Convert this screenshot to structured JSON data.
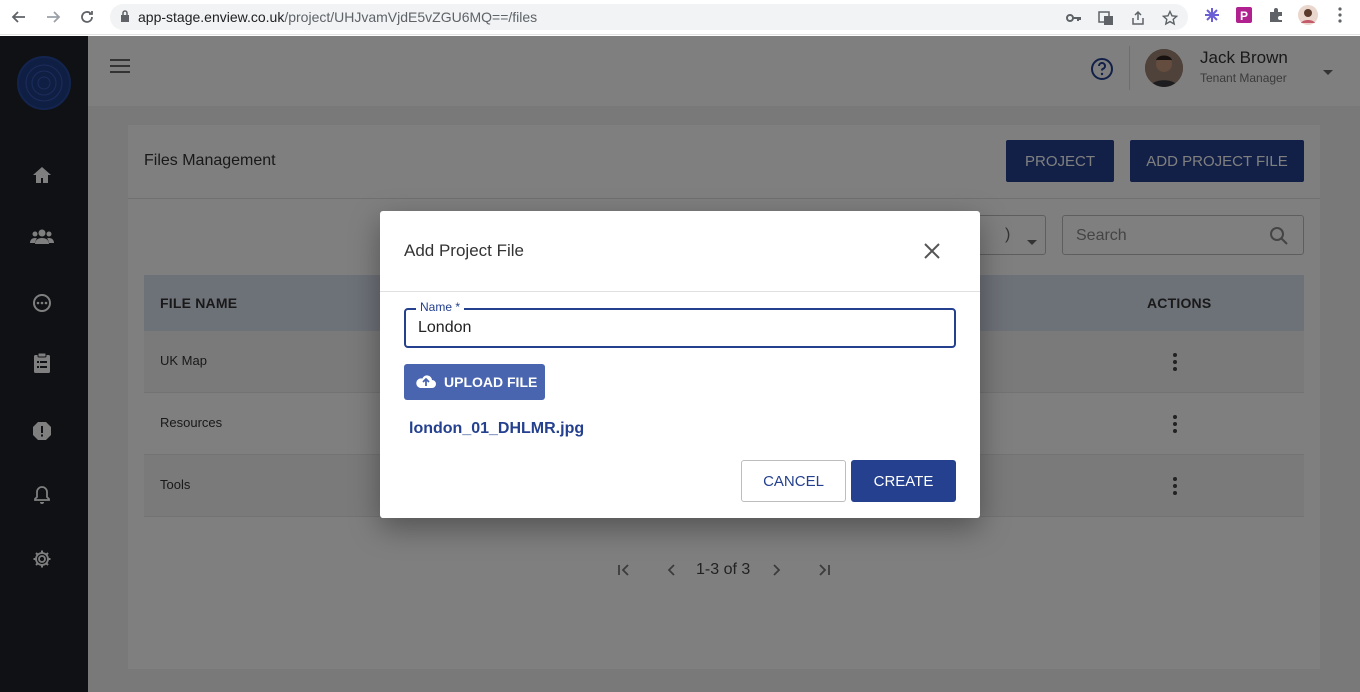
{
  "browser": {
    "url_host": "app-stage.enview.co.uk",
    "url_path": "/project/UHJvamVjdE5vZGU6MQ==/files"
  },
  "sidebar": {
    "items": [
      {
        "icon": "home-icon"
      },
      {
        "icon": "users-icon"
      },
      {
        "icon": "dots-circle-icon"
      },
      {
        "icon": "clipboard-icon"
      },
      {
        "icon": "alert-icon"
      },
      {
        "icon": "bell-icon"
      },
      {
        "icon": "gear-icon"
      }
    ]
  },
  "header": {
    "user_name": "Jack Brown",
    "user_role": "Tenant Manager"
  },
  "page": {
    "title": "Files Management",
    "project_button": "PROJECT",
    "add_file_button": "ADD PROJECT FILE",
    "search_placeholder": "Search",
    "select_value": ")"
  },
  "table": {
    "columns": [
      "FILE NAME",
      "ACTIONS"
    ],
    "rows": [
      {
        "name": "UK Map"
      },
      {
        "name": "Resources"
      },
      {
        "name": "Tools"
      }
    ]
  },
  "pagination": {
    "range": "1-3 of 3"
  },
  "dialog": {
    "title": "Add Project File",
    "name_label": "Name *",
    "name_value": "London",
    "upload_label": "UPLOAD FILE",
    "file_name": "london_01_DHLMR.jpg",
    "cancel_label": "CANCEL",
    "create_label": "CREATE"
  },
  "colors": {
    "primary": "#24408e",
    "sidebar": "#1e2328",
    "table_header": "#dbe2f1"
  }
}
